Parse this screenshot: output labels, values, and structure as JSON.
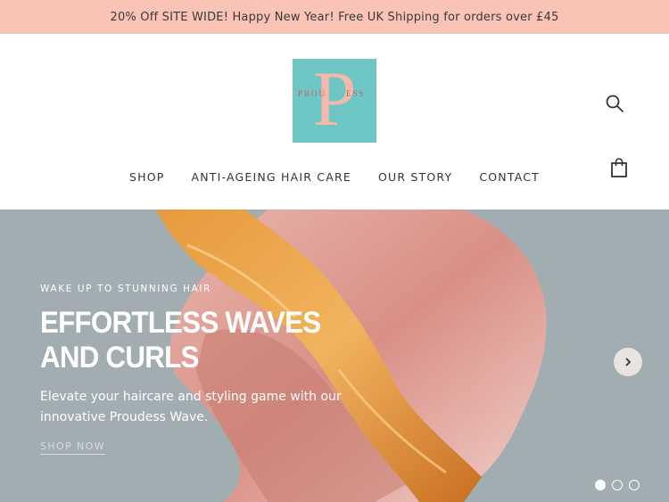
{
  "announcement": "20% Off SITE WIDE! Happy New Year! Free UK Shipping for orders over £45",
  "brand": {
    "logo_letter": "P",
    "logo_left": "PROU",
    "logo_right": "ESS"
  },
  "nav": {
    "items": [
      "SHOP",
      "ANTI-AGEING HAIR CARE",
      "OUR STORY",
      "CONTACT"
    ]
  },
  "icons": {
    "search": "search-icon",
    "cart": "shopping-bag-icon",
    "next": "chevron-right-icon"
  },
  "hero": {
    "eyebrow": "WAKE UP TO STUNNING HAIR",
    "title": "EFFORTLESS WAVES AND CURLS",
    "description": "Elevate your haircare and styling game with our innovative Proudess Wave.",
    "cta": "SHOP NOW",
    "slides": {
      "count": 3,
      "active_index": 0
    }
  },
  "colors": {
    "announcement_bg": "#f9c3b6",
    "logo_bg": "#6ec7c4",
    "hero_bg": "#a2adb1"
  }
}
